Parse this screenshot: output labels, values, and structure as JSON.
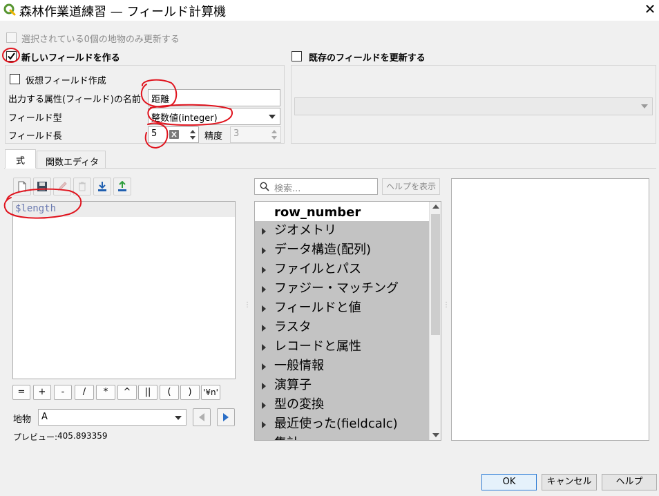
{
  "window": {
    "title": "森林作業道練習 — フィールド計算機",
    "close_symbol": "✕"
  },
  "top": {
    "selected_only_label": "選択されている0個の地物のみ更新する",
    "create_new_field_label": "新しいフィールドを作る",
    "update_existing_label": "既存のフィールドを更新する"
  },
  "new_field": {
    "virtual_field_label": "仮想フィールド作成",
    "output_name_label": "出力する属性(フィールド)の名前",
    "output_name_value": "距離",
    "field_type_label": "フィールド型",
    "field_type_value": "整数値(integer)",
    "field_length_label": "フィールド長",
    "field_length_value": "5",
    "precision_label": "精度",
    "precision_value": "3"
  },
  "tabs": [
    {
      "label": "式"
    },
    {
      "label": "関数エディタ"
    }
  ],
  "expression": {
    "code": "$length",
    "operators": [
      "=",
      "+",
      "-",
      "/",
      "*",
      "^",
      "||",
      "(",
      ")",
      "'¥n'"
    ],
    "feature_label": "地物",
    "feature_value": "A",
    "preview_label": "プレビュー:",
    "preview_value": "405.893359"
  },
  "functions": {
    "search_placeholder": "検索...",
    "help_button_label": "ヘルプを表示",
    "items": [
      {
        "label": "row_number"
      },
      {
        "label": "ジオメトリ"
      },
      {
        "label": "データ構造(配列)"
      },
      {
        "label": "ファイルとパス"
      },
      {
        "label": "ファジー・マッチング"
      },
      {
        "label": "フィールドと値"
      },
      {
        "label": "ラスタ"
      },
      {
        "label": "レコードと属性"
      },
      {
        "label": "一般情報"
      },
      {
        "label": "演算子"
      },
      {
        "label": "型の変換"
      },
      {
        "label": "最近使った(fieldcalc)"
      },
      {
        "label": "集計"
      }
    ]
  },
  "buttons": {
    "ok_label": "OK",
    "cancel_label": "キャンセル",
    "help_label": "ヘルプ"
  },
  "colors": {
    "accent": "#2a7ad5",
    "annotation": "#e0141e",
    "qgis_green": "#589632"
  }
}
